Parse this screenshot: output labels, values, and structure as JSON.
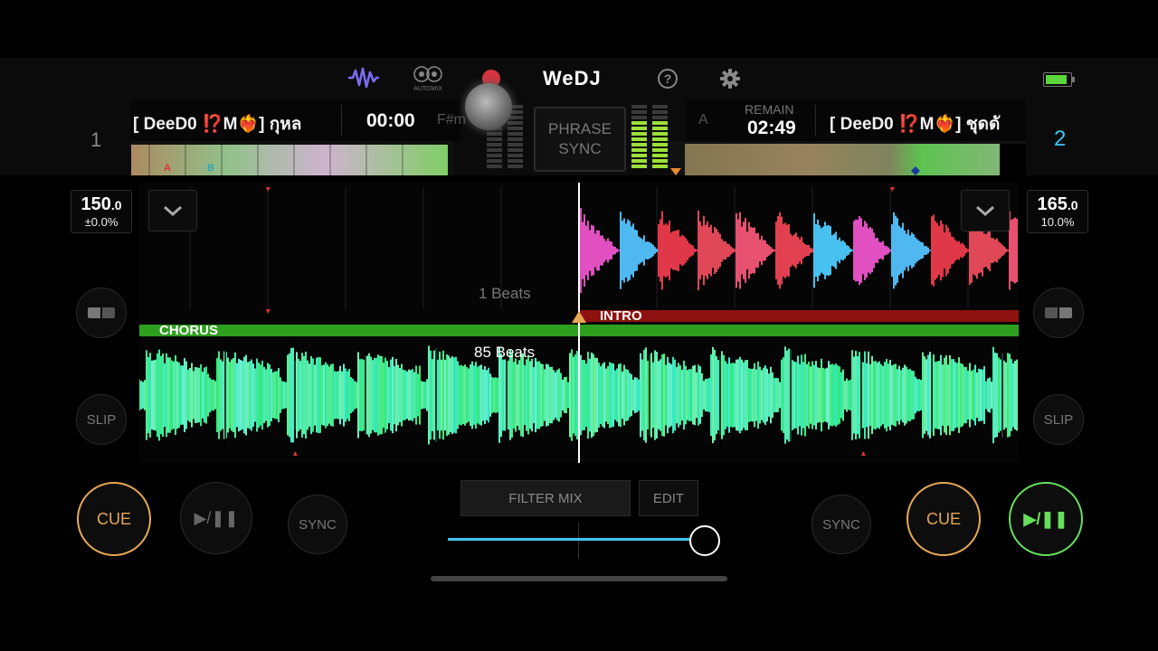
{
  "app": {
    "name": "WeDJ",
    "automix_label": "AUTOMIX"
  },
  "colors": {
    "accent_blue": "#3ec5f0",
    "cue_orange": "#e7a855",
    "play_green": "#66df5c",
    "chorus_green": "#2e9e1f",
    "intro_red": "#8e1210",
    "battery_green": "#5bd63b"
  },
  "deck1": {
    "number": "1",
    "title": "[ DeeD0 ⁉️M❤️‍🔥] กุหล",
    "time": "00:00",
    "key": "F#m",
    "bpm_int": "150",
    "bpm_dec": ".0",
    "pitch": "±0.0%",
    "beat_countdown": "1 Beats",
    "phrase_label": "CHORUS",
    "cue_label": "CUE",
    "sync_label": "SYNC",
    "slip_label": "SLIP",
    "overview_markers": [
      "A",
      "B"
    ]
  },
  "deck2": {
    "number": "2",
    "title": "[ DeeD0 ⁉️M❤️‍🔥] ชุดดั",
    "remain_label": "REMAIN",
    "time": "02:49",
    "key": "A",
    "bpm_int": "165",
    "bpm_dec": ".0",
    "pitch": "10.0%",
    "phrase_label": "INTRO",
    "beat_countdown": "85 Beats",
    "cue_label": "CUE",
    "sync_label": "SYNC",
    "slip_label": "SLIP"
  },
  "center": {
    "phrase_sync_line1": "PHRASE",
    "phrase_sync_line2": "SYNC",
    "filter_mix_label": "FILTER MIX",
    "edit_label": "EDIT",
    "crossfader_position": 0.95
  },
  "icons": [
    "waveform-icon",
    "automix-icon",
    "record-icon",
    "help-icon",
    "gear-icon",
    "battery-icon",
    "chevron-down-icon",
    "loop-icon",
    "play-pause-icon"
  ]
}
